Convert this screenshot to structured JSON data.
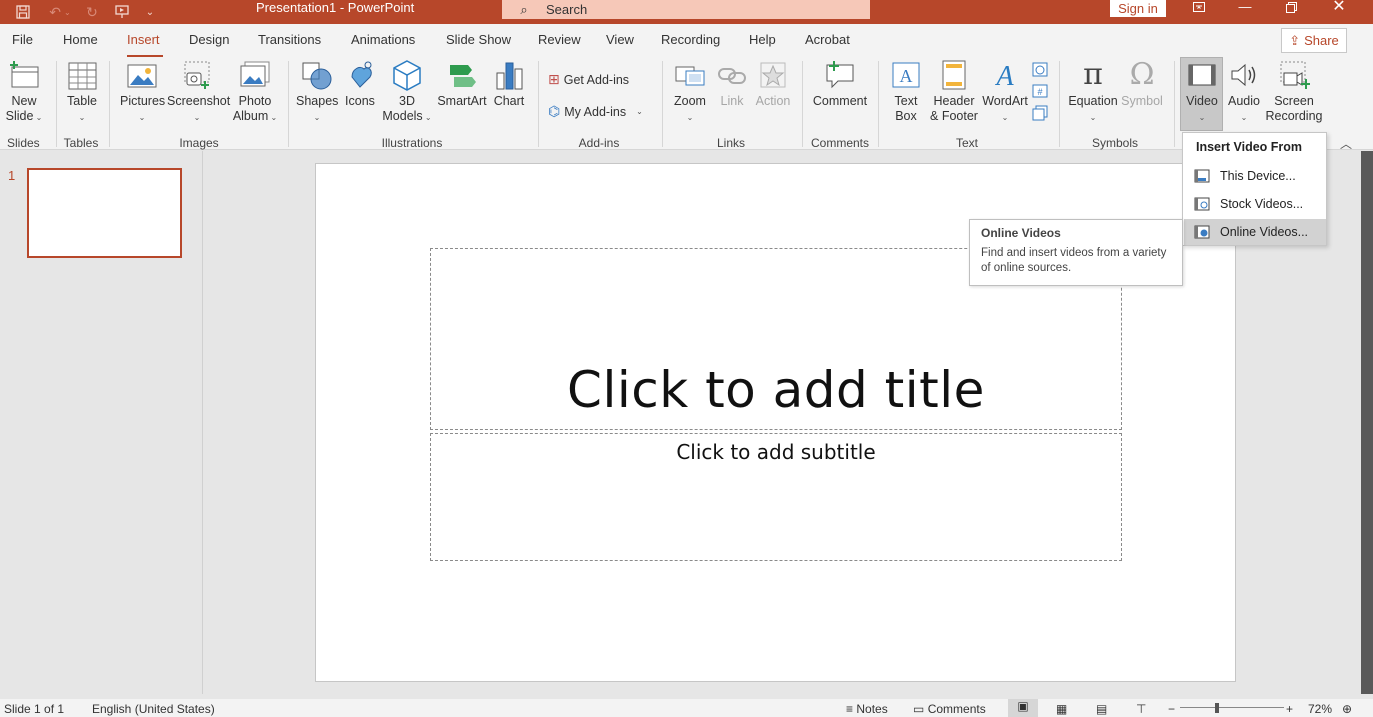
{
  "window": {
    "title": "Presentation1  -  PowerPoint",
    "search_placeholder": "Search",
    "signin_label": "Sign in"
  },
  "tabs": [
    {
      "label": "File"
    },
    {
      "label": "Home"
    },
    {
      "label": "Insert",
      "active": true
    },
    {
      "label": "Design"
    },
    {
      "label": "Transitions"
    },
    {
      "label": "Animations"
    },
    {
      "label": "Slide Show"
    },
    {
      "label": "Review"
    },
    {
      "label": "View"
    },
    {
      "label": "Recording"
    },
    {
      "label": "Help"
    },
    {
      "label": "Acrobat"
    }
  ],
  "share_label": "Share",
  "ribbon": {
    "slides": {
      "new_slide_1": "New",
      "new_slide_2": "Slide",
      "group": "Slides"
    },
    "tables": {
      "table": "Table",
      "group": "Tables"
    },
    "images": {
      "pictures": "Pictures",
      "screenshot": "Screenshot",
      "photo_album_1": "Photo",
      "photo_album_2": "Album",
      "group": "Images"
    },
    "illustrations": {
      "shapes": "Shapes",
      "icons": "Icons",
      "models_1": "3D",
      "models_2": "Models",
      "smartart": "SmartArt",
      "chart": "Chart",
      "group": "Illustrations"
    },
    "addins": {
      "get": "Get Add-ins",
      "my": "My Add-ins",
      "group": "Add-ins"
    },
    "links": {
      "zoom": "Zoom",
      "link": "Link",
      "action": "Action",
      "group": "Links"
    },
    "comments": {
      "comment": "Comment",
      "group": "Comments"
    },
    "text": {
      "textbox_1": "Text",
      "textbox_2": "Box",
      "header_1": "Header",
      "header_2": "& Footer",
      "wordart": "WordArt",
      "group": "Text"
    },
    "symbols": {
      "equation": "Equation",
      "symbol": "Symbol",
      "group": "Symbols"
    },
    "media": {
      "video": "Video",
      "audio": "Audio",
      "screen_1": "Screen",
      "screen_2": "Recording"
    }
  },
  "thumbnail": {
    "number": "1"
  },
  "slide": {
    "title_placeholder": "Click to add title",
    "subtitle_placeholder": "Click to add subtitle"
  },
  "video_menu": {
    "header": "Insert Video From",
    "items": [
      {
        "label": "This Device...",
        "icon": "film-device-icon"
      },
      {
        "label": "Stock Videos...",
        "icon": "film-stock-icon"
      },
      {
        "label": "Online Videos...",
        "icon": "film-online-icon",
        "highlighted": true
      }
    ]
  },
  "tooltip": {
    "title": "Online Videos",
    "description": "Find and insert videos from a variety of online sources."
  },
  "status": {
    "slide": "Slide 1 of 1",
    "language": "English (United States)",
    "notes": "Notes",
    "comments": "Comments",
    "zoom": "72%"
  },
  "colors": {
    "accent": "#b7472a",
    "search_bg": "#f6c8b8"
  }
}
